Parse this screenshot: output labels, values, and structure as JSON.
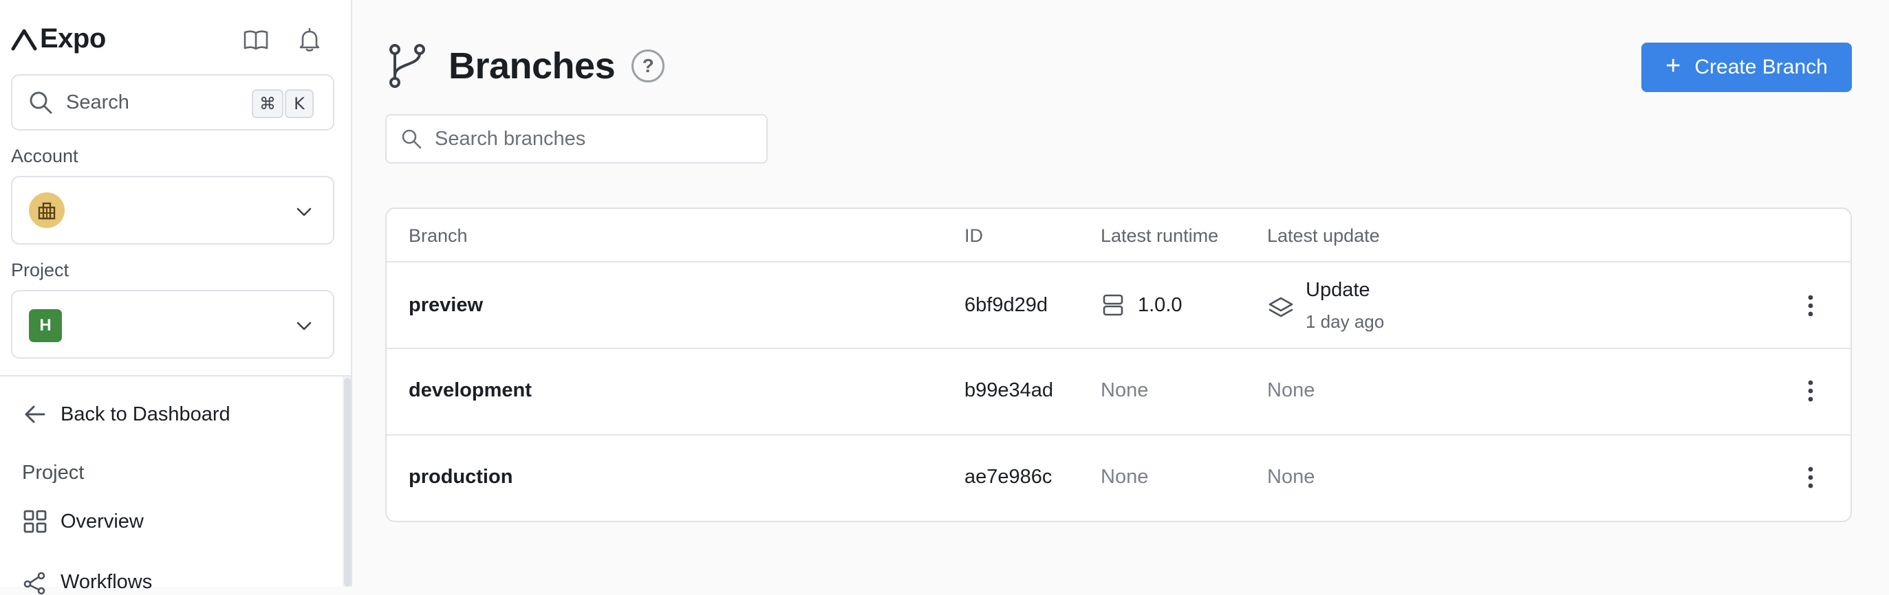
{
  "sidebar": {
    "brand": "Expo",
    "icons": {
      "docs": "book-icon",
      "notifications": "bell-icon"
    },
    "search": {
      "label": "Search",
      "shortcut_modifier": "⌘",
      "shortcut_key": "K"
    },
    "account_label": "Account",
    "project_label": "Project",
    "project_avatar_letter": "H",
    "back_label": "Back to Dashboard",
    "section_label": "Project",
    "nav": [
      {
        "label": "Overview",
        "icon": "grid-icon"
      },
      {
        "label": "Workflows",
        "icon": "workflow-icon"
      }
    ]
  },
  "main": {
    "title": "Branches",
    "help_symbol": "?",
    "create_button": {
      "plus": "+",
      "label": "Create Branch"
    },
    "search_placeholder": "Search branches",
    "table": {
      "columns": [
        "Branch",
        "ID",
        "Latest runtime",
        "Latest update"
      ],
      "rows": [
        {
          "branch": "preview",
          "id": "6bf9d29d",
          "runtime": "1.0.0",
          "update_title": "Update",
          "update_time": "1 day ago"
        },
        {
          "branch": "development",
          "id": "b99e34ad",
          "runtime": "None",
          "update": "None"
        },
        {
          "branch": "production",
          "id": "ae7e986c",
          "runtime": "None",
          "update": "None"
        }
      ]
    }
  },
  "colors": {
    "accent": "#3984e6",
    "account_avatar": "#e7c776",
    "project_avatar": "#3f8a3f",
    "muted_text": "#7b8089"
  }
}
